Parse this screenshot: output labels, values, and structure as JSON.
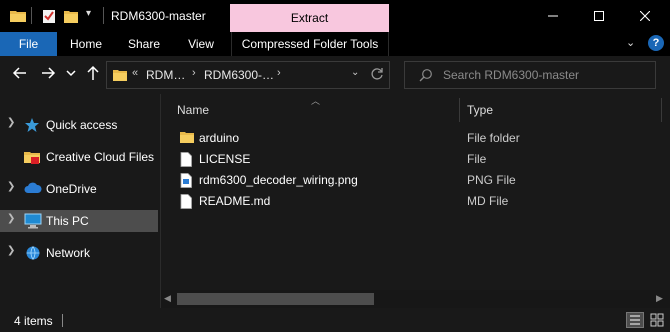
{
  "window": {
    "title": "RDM6300-master",
    "contextual_tab": "Extract"
  },
  "ribbon": {
    "tabs": [
      {
        "label": "File"
      },
      {
        "label": "Home"
      },
      {
        "label": "Share"
      },
      {
        "label": "View"
      },
      {
        "label": "Compressed Folder Tools"
      }
    ]
  },
  "navigation": {
    "breadcrumb_overflow": "«",
    "breadcrumbs": [
      "RDM…",
      "RDM6300-…"
    ],
    "search_placeholder": "Search RDM6300-master"
  },
  "sidebar": {
    "items": [
      {
        "label": "Quick access",
        "icon": "star-icon",
        "selected": false
      },
      {
        "label": "Creative Cloud Files",
        "icon": "creative-cloud-folder-icon",
        "selected": false
      },
      {
        "label": "OneDrive",
        "icon": "cloud-icon",
        "selected": false
      },
      {
        "label": "This PC",
        "icon": "computer-icon",
        "selected": true
      },
      {
        "label": "Network",
        "icon": "network-icon",
        "selected": false
      }
    ]
  },
  "file_list": {
    "columns": [
      "Name",
      "Type"
    ],
    "rows": [
      {
        "name": "arduino",
        "type": "File folder",
        "icon": "folder-icon"
      },
      {
        "name": "LICENSE",
        "type": "File",
        "icon": "file-icon"
      },
      {
        "name": "rdm6300_decoder_wiring.png",
        "type": "PNG File",
        "icon": "image-file-icon"
      },
      {
        "name": "README.md",
        "type": "MD File",
        "icon": "file-icon"
      }
    ]
  },
  "status": {
    "item_count": "4 items"
  },
  "colors": {
    "background": "#191919",
    "titlebar": "#000000",
    "accent_file_tab": "#1a67b6",
    "contextual_tab": "#f8c7de",
    "selected_item": "#4d4d4d",
    "folder": "#e8b94a"
  }
}
